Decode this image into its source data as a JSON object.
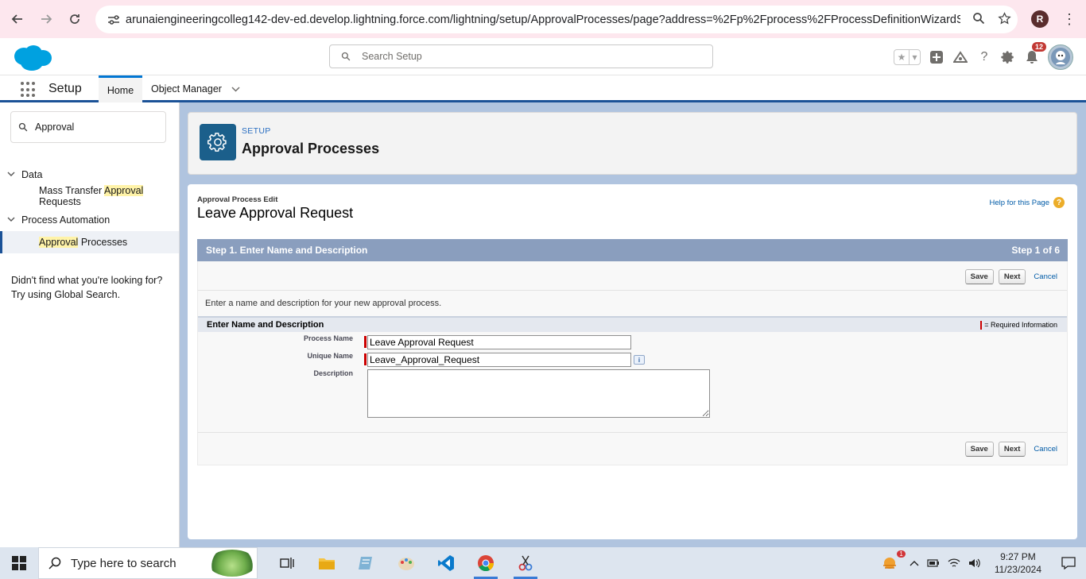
{
  "browser": {
    "url": "arunaiengineeringcolleg142-dev-ed.develop.lightning.force.com/lightning/setup/ApprovalProcesses/page?address=%2Fp%2Fprocess%2FProcessDefinitionWizardStage...",
    "profile_initial": "R"
  },
  "header": {
    "search_placeholder": "Search Setup",
    "notification_count": "12"
  },
  "context_bar": {
    "app_name": "Setup",
    "tabs": [
      {
        "label": "Home"
      },
      {
        "label": "Object Manager"
      }
    ]
  },
  "sidebar": {
    "quick_find_value": "Approval",
    "groups": [
      {
        "label": "Data",
        "item_pre": "Mass Transfer ",
        "item_highlight": "Approval",
        "item_post": " Requests"
      },
      {
        "label": "Process Automation",
        "item_highlight": "Approval",
        "item_post": " Processes"
      }
    ],
    "not_found_line1": "Didn't find what you're looking for?",
    "not_found_line2": "Try using Global Search."
  },
  "page_header": {
    "eyebrow": "SETUP",
    "title": "Approval Processes"
  },
  "content": {
    "edit_label": "Approval Process Edit",
    "record_title": "Leave Approval Request",
    "help_link": "Help for this Page",
    "step_title": "Step 1. Enter Name and Description",
    "step_count": "Step 1 of 6",
    "buttons": {
      "save": "Save",
      "next": "Next",
      "cancel": "Cancel"
    },
    "instruction": "Enter a name and description for your new approval process.",
    "section_title": "Enter Name and Description",
    "required_info": "= Required Information",
    "fields": {
      "process_name_label": "Process Name",
      "process_name_value": "Leave Approval Request",
      "unique_name_label": "Unique Name",
      "unique_name_value": "Leave_Approval_Request",
      "description_label": "Description",
      "description_value": ""
    }
  },
  "taskbar": {
    "search_placeholder": "Type here to search",
    "time": "9:27 PM",
    "date": "11/23/2024",
    "weather_badge": "1"
  },
  "colors": {
    "brand_blue": "#1b5297",
    "step_bar": "#8a9ebe",
    "required_red": "#cc0000"
  }
}
